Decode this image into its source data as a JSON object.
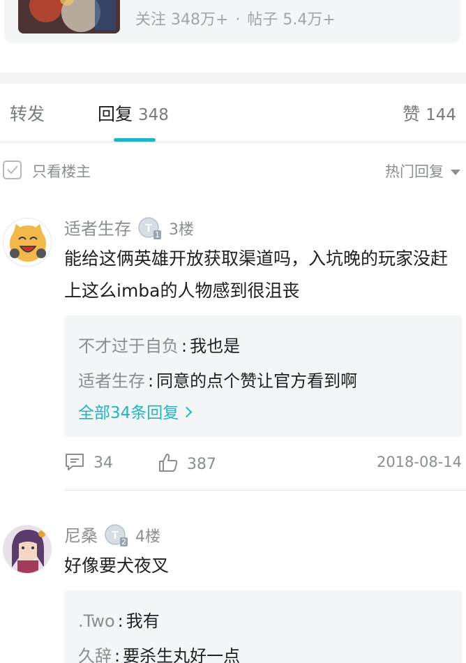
{
  "forum": {
    "stats_follow": "关注 348万+",
    "stats_sep": "·",
    "stats_posts": "帖子 5.4万+"
  },
  "tabs": {
    "repost": "转发",
    "reply": "回复",
    "reply_count": "348",
    "like": "赞",
    "like_count": "144"
  },
  "filter": {
    "only_op": "只看楼主",
    "sort": "热门回复"
  },
  "accent_color": "#1fb5c4",
  "comments": [
    {
      "name": "适者生存",
      "level_icon": "T1-level-badge",
      "level_sub": "1",
      "floor": "3楼",
      "content": "能给这俩英雄开放获取渠道吗，入坑晚的玩家没赶上这么imba的人物感到很沮丧",
      "replies": [
        {
          "user": "不才过于自负",
          "text": "我也是"
        },
        {
          "user": "适者生存",
          "text": "同意的点个赞让官方看到啊"
        }
      ],
      "more": "全部34条回复",
      "reply_count": "34",
      "like_count": "387",
      "date": "2018-08-14"
    },
    {
      "name": "尼桑",
      "level_icon": "T2-level-badge",
      "level_sub": "2",
      "floor": "4楼",
      "content": "好像要犬夜叉",
      "replies": [
        {
          "user": ".Two",
          "text": "我有"
        },
        {
          "user": "久辞",
          "text": "要杀生丸好一点"
        }
      ]
    }
  ]
}
